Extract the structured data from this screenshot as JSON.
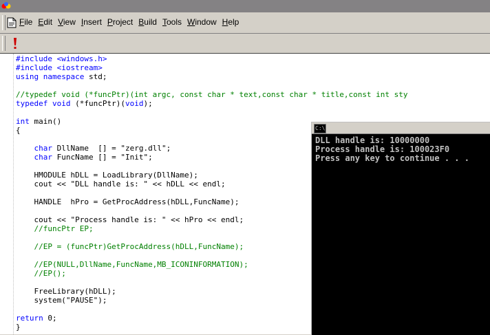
{
  "menubar": {
    "items": [
      {
        "label": "File",
        "accel": "F",
        "rest": "ile"
      },
      {
        "label": "Edit",
        "accel": "E",
        "rest": "dit"
      },
      {
        "label": "View",
        "accel": "V",
        "rest": "iew"
      },
      {
        "label": "Insert",
        "accel": "I",
        "rest": "nsert"
      },
      {
        "label": "Project",
        "accel": "P",
        "rest": "roject"
      },
      {
        "label": "Build",
        "accel": "B",
        "rest": "uild"
      },
      {
        "label": "Tools",
        "accel": "T",
        "rest": "ools"
      },
      {
        "label": "Window",
        "accel": "W",
        "rest": "indow"
      },
      {
        "label": "Help",
        "accel": "H",
        "rest": "elp"
      }
    ]
  },
  "toolbar": {
    "execute_icon": "exclamation-icon"
  },
  "editor": {
    "lines": [
      [
        {
          "t": "#include <windows.h>",
          "c": "kw"
        }
      ],
      [
        {
          "t": "#include <iostream>",
          "c": "kw"
        }
      ],
      [
        {
          "t": "using namespace",
          "c": "kw"
        },
        {
          "t": " std;",
          "c": ""
        }
      ],
      [],
      [
        {
          "t": "//typedef void (*funcPtr)(int argc, const char * text,const char * title,const int sty",
          "c": "cm"
        }
      ],
      [
        {
          "t": "typedef void",
          "c": "kw"
        },
        {
          "t": " (*funcPtr)(",
          "c": ""
        },
        {
          "t": "void",
          "c": "kw"
        },
        {
          "t": ");",
          "c": ""
        }
      ],
      [],
      [
        {
          "t": "int",
          "c": "kw"
        },
        {
          "t": " main()",
          "c": ""
        }
      ],
      [
        {
          "t": "{",
          "c": ""
        }
      ],
      [],
      [
        {
          "t": "    ",
          "c": ""
        },
        {
          "t": "char",
          "c": "kw"
        },
        {
          "t": " DllName  [] = \"zerg.dll\";",
          "c": ""
        }
      ],
      [
        {
          "t": "    ",
          "c": ""
        },
        {
          "t": "char",
          "c": "kw"
        },
        {
          "t": " FuncName [] = \"Init\";",
          "c": ""
        }
      ],
      [],
      [
        {
          "t": "    HMODULE hDLL = LoadLibrary(DllName);",
          "c": ""
        }
      ],
      [
        {
          "t": "    cout << \"DLL handle is: \" << hDLL << endl;",
          "c": ""
        }
      ],
      [],
      [
        {
          "t": "    HANDLE  hPro = GetProcAddress(hDLL,FuncName);",
          "c": ""
        }
      ],
      [],
      [
        {
          "t": "    cout << \"Process handle is: \" << hPro << endl;",
          "c": ""
        }
      ],
      [
        {
          "t": "    ",
          "c": ""
        },
        {
          "t": "//funcPtr EP;",
          "c": "cm"
        }
      ],
      [],
      [
        {
          "t": "    ",
          "c": ""
        },
        {
          "t": "//EP = (funcPtr)GetProcAddress(hDLL,FuncName);",
          "c": "cm"
        }
      ],
      [],
      [
        {
          "t": "    ",
          "c": ""
        },
        {
          "t": "//EP(NULL,DllName,FuncName,MB_ICONINFORMATION);",
          "c": "cm"
        }
      ],
      [
        {
          "t": "    ",
          "c": ""
        },
        {
          "t": "//EP();",
          "c": "cm"
        }
      ],
      [],
      [
        {
          "t": "    FreeLibrary(hDLL);",
          "c": ""
        }
      ],
      [
        {
          "t": "    system(\"PAUSE\");",
          "c": ""
        }
      ],
      [],
      [
        {
          "t": "return",
          "c": "kw"
        },
        {
          "t": " 0;",
          "c": ""
        }
      ],
      [
        {
          "t": "}",
          "c": ""
        }
      ]
    ]
  },
  "console": {
    "title_icon_text": "C:\\",
    "output": [
      "DLL handle is: 10000000",
      "Process handle is: 100023F0",
      "Press any key to continue . . ."
    ]
  },
  "colors": {
    "keyword": "#0000ff",
    "comment": "#008000",
    "console_text": "#c0c0c0"
  }
}
